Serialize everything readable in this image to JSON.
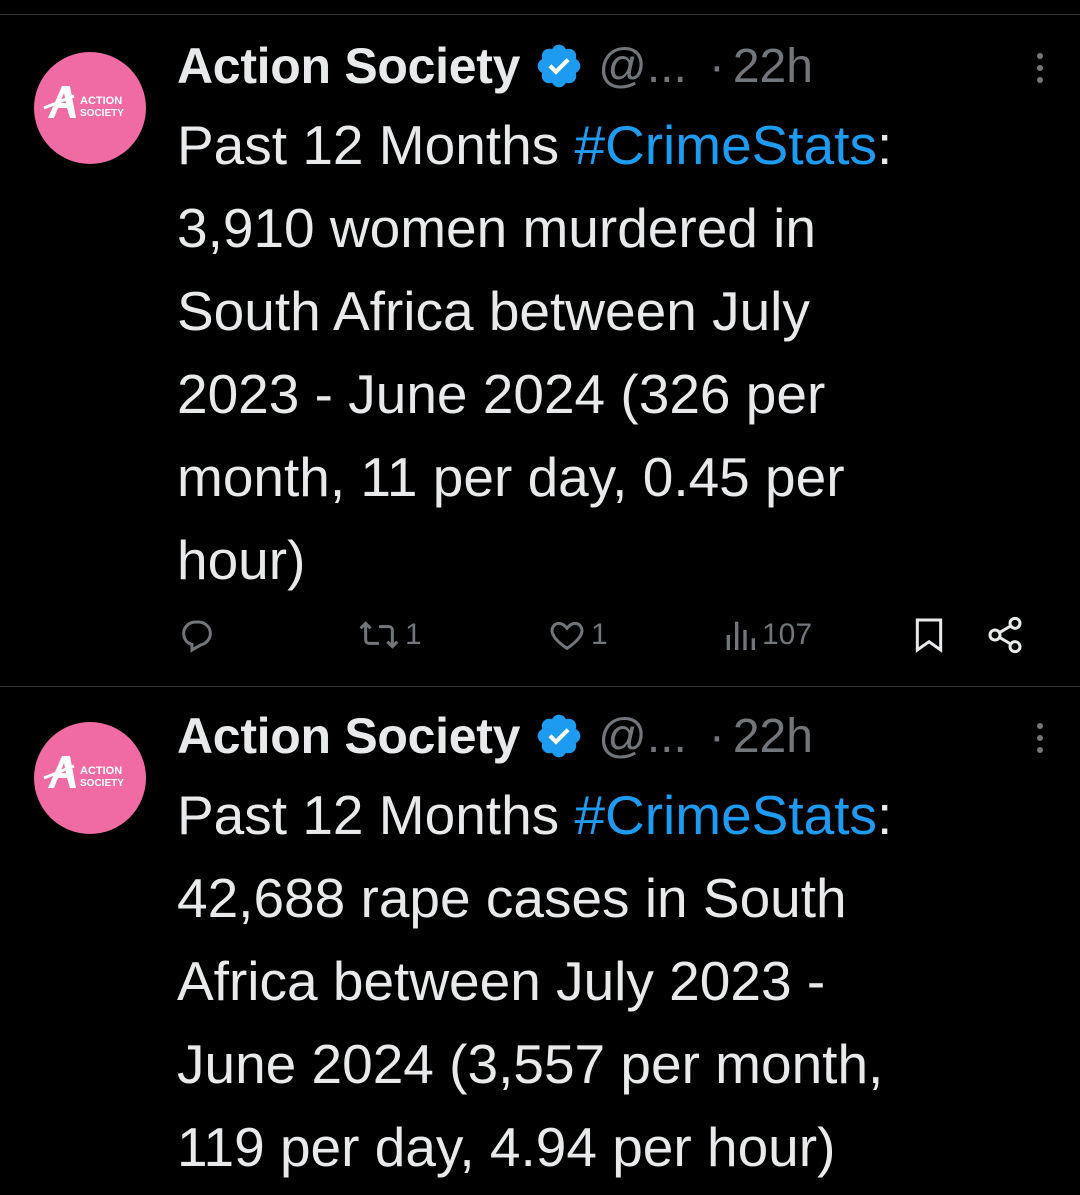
{
  "colors": {
    "background": "#000000",
    "text": "#e7e9ea",
    "muted": "#71767b",
    "hashtag": "#1d9bf0",
    "avatar": "#f06aa3",
    "verified": "#1d9bf0"
  },
  "tweets": [
    {
      "avatar_text": [
        "ACTION",
        "SOCIETY"
      ],
      "display_name": "Action Society",
      "verified": true,
      "handle": "@...",
      "separator": "·",
      "time": "22h",
      "text_lines": [
        {
          "before": "Past 12 Months ",
          "hashtag": "#CrimeStats",
          "after": ":"
        },
        {
          "text": "3,910 women murdered in"
        },
        {
          "text": "South Africa between July"
        },
        {
          "text": "2023 - June 2024 (326 per"
        },
        {
          "text": "month, 11 per day, 0.45 per"
        },
        {
          "text": "hour)"
        }
      ],
      "actions": {
        "replies": "",
        "retweets": "1",
        "likes": "1",
        "views": "107"
      },
      "icons": [
        "reply-icon",
        "retweet-icon",
        "like-icon",
        "views-icon",
        "bookmark-icon",
        "share-icon"
      ]
    },
    {
      "avatar_text": [
        "ACTION",
        "SOCIETY"
      ],
      "display_name": "Action Society",
      "verified": true,
      "handle": "@...",
      "separator": "·",
      "time": "22h",
      "text_lines": [
        {
          "before": "Past 12 Months ",
          "hashtag": "#CrimeStats",
          "after": ":"
        },
        {
          "text": "42,688 rape cases in South"
        },
        {
          "text": "Africa between July 2023 -"
        },
        {
          "text": "June 2024 (3,557 per month,"
        },
        {
          "text": "119 per day, 4.94 per hour)"
        }
      ]
    }
  ]
}
